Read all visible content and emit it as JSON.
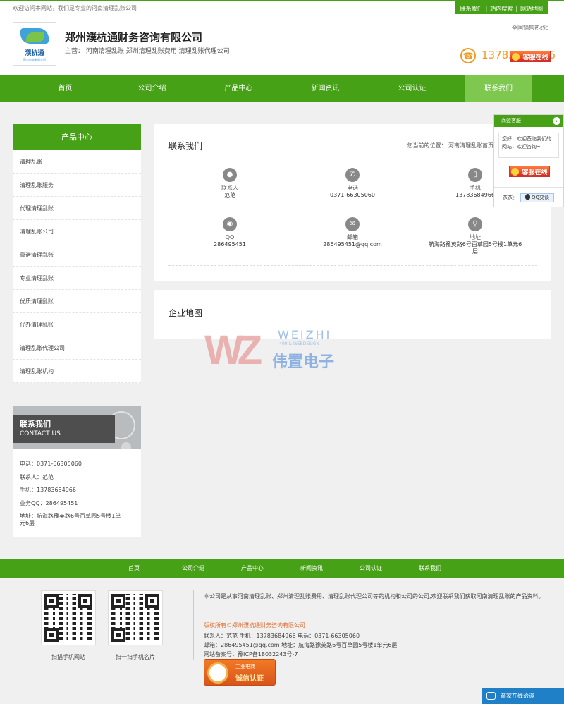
{
  "topbar": {
    "welcome": "欢迎访问本网站，我们是专业的河南清理乱账公司",
    "links": [
      "联系我们",
      "站内搜索",
      "网站地图"
    ]
  },
  "header": {
    "logo_text": "濮杭通",
    "logo_sub": "财务咨询有限公司",
    "company": "郑州濮杭通财务咨询有限公司",
    "main_business": "主营： 河南清理乱账 郑州清理乱账费用 清理乱账代理公司",
    "hotline_label": "全国销售热线：",
    "hotline": "13783684966",
    "kefu_label": "客服在线"
  },
  "nav": {
    "items": [
      "首页",
      "公司介绍",
      "产品中心",
      "新闻资讯",
      "公司认证",
      "联系我们"
    ],
    "active_index": 5
  },
  "sidebar": {
    "title": "产品中心",
    "items": [
      "清理乱账",
      "清理乱账服务",
      "代理清理乱账",
      "清理乱账公司",
      "靠谱清理乱账",
      "专业清理乱账",
      "优质清理乱账",
      "代办清理乱账",
      "清理乱账代理公司",
      "清理乱账机构"
    ]
  },
  "contact_box": {
    "title": "联系我们",
    "subtitle": "CONTACT US",
    "phone": "电话：0371-66305060",
    "person": "联系人：范范",
    "mobile": "手机：13783684966",
    "qq": "业务QQ：286495451",
    "address_1": "地址：航海路豫英路6号百草园5号楼1单",
    "address_2": "元6层"
  },
  "main": {
    "title": "联系我们",
    "breadcrumb": "您当前的位置： 河南清理乱账首页",
    "contacts": [
      {
        "label": "联系人",
        "value": "范范",
        "icon": "person-icon"
      },
      {
        "label": "电话",
        "value": "0371-66305060",
        "icon": "phone-icon"
      },
      {
        "label": "手机",
        "value": "13783684966",
        "icon": "mobile-icon"
      },
      {
        "label": "QQ",
        "value": "286495451",
        "icon": "qq-icon"
      },
      {
        "label": "邮箱",
        "value": "286495451@qq.com",
        "icon": "mail-icon"
      },
      {
        "label": "地址",
        "value": "航海路豫英路6号百草园5号楼1单元6",
        "value2": "层",
        "icon": "location-icon"
      }
    ],
    "map_title": "企业地图"
  },
  "watermark": {
    "letters": "WZ",
    "name": "WEIZHI",
    "sub": "400 & WEBDESIGN",
    "cn": "伟置电子"
  },
  "float_service": {
    "title": "商盟客服",
    "message": "您好，欢迎莅临我们的网站，欢迎咨询~",
    "kefu_label": "客服在线",
    "name": "范范：",
    "qq_label": "QQ交谈"
  },
  "footer": {
    "nav": [
      "首页",
      "公司介绍",
      "产品中心",
      "新闻资讯",
      "公司认证",
      "联系我们"
    ],
    "qr1_label": "扫描手机网站",
    "qr2_label": "扫一扫手机名片",
    "intro": "本公司是从事河南清理乱账、郑州清理乱账费用、清理乱账代理公司等的机构和公司的公司,欢迎联系我们获取河南清理乱账的产品资料。",
    "copyright": "版权所有©郑州濮杭通财务咨询有限公司",
    "line1": "联系人：范范    手机：13783684966    电话：0371-66305060",
    "line2": "邮箱：286495451@qq.com    地址：航海路豫英路6号百草园5号楼1单元6层",
    "line3": "网站备案号：豫ICP备18032243号-7",
    "cert_t1": "工业电商",
    "cert_t2": "诚信认证"
  },
  "chatbar": {
    "label": "商家在线洽谈"
  },
  "colors": {
    "brand_green": "#46a116",
    "nav_active": "#7ec850",
    "accent_orange": "#f39a1d"
  }
}
